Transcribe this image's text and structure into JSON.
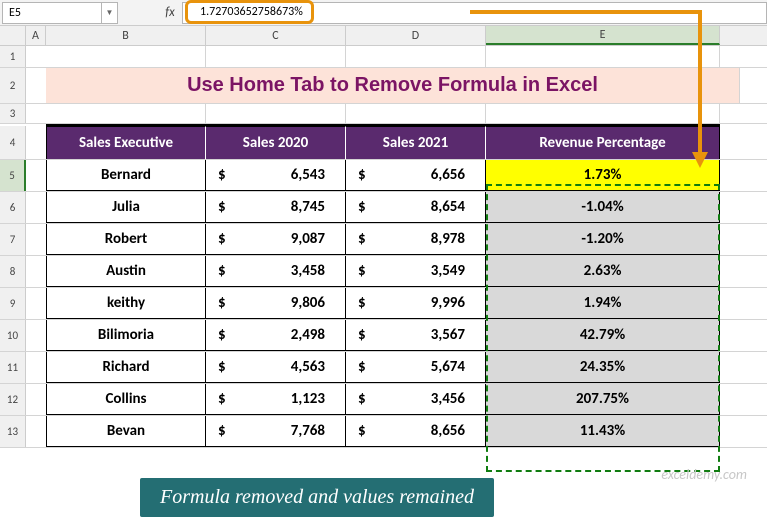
{
  "name_box": "E5",
  "formula_bar": "1.72703652758673%",
  "col_headers": {
    "A": "A",
    "B": "B",
    "C": "C",
    "D": "D",
    "E": "E"
  },
  "row_headers": [
    "1",
    "2",
    "3",
    "4",
    "5",
    "6",
    "7",
    "8",
    "9",
    "10",
    "11",
    "12",
    "13"
  ],
  "title": "Use Home Tab to Remove Formula in Excel",
  "headers": {
    "exec": "Sales Executive",
    "s2020": "Sales 2020",
    "s2021": "Sales 2021",
    "rev": "Revenue Percentage"
  },
  "rows": [
    {
      "exec": "Bernard",
      "s20": "6,543",
      "s21": "6,656",
      "pct": "1.73%"
    },
    {
      "exec": "Julia",
      "s20": "8,745",
      "s21": "8,654",
      "pct": "-1.04%"
    },
    {
      "exec": "Robert",
      "s20": "9,087",
      "s21": "8,978",
      "pct": "-1.20%"
    },
    {
      "exec": "Austin",
      "s20": "3,458",
      "s21": "3,549",
      "pct": "2.63%"
    },
    {
      "exec": "keithy",
      "s20": "9,806",
      "s21": "9,996",
      "pct": "1.94%"
    },
    {
      "exec": "Bilimoria",
      "s20": "2,498",
      "s21": "3,567",
      "pct": "42.79%"
    },
    {
      "exec": "Richard",
      "s20": "4,563",
      "s21": "5,674",
      "pct": "24.35%"
    },
    {
      "exec": "Collins",
      "s20": "1,123",
      "s21": "3,456",
      "pct": "207.75%"
    },
    {
      "exec": "Bevan",
      "s20": "7,768",
      "s21": "8,656",
      "pct": "11.43%"
    }
  ],
  "currency": "$",
  "note": "Formula removed and values remained",
  "watermark": "exceldemy.com",
  "chart_data": {
    "type": "table",
    "title": "Use Home Tab to Remove Formula in Excel",
    "columns": [
      "Sales Executive",
      "Sales 2020",
      "Sales 2021",
      "Revenue Percentage"
    ],
    "series": [
      {
        "name": "Bernard",
        "values": [
          6543,
          6656,
          1.73
        ]
      },
      {
        "name": "Julia",
        "values": [
          8745,
          8654,
          -1.04
        ]
      },
      {
        "name": "Robert",
        "values": [
          9087,
          8978,
          -1.2
        ]
      },
      {
        "name": "Austin",
        "values": [
          3458,
          3549,
          2.63
        ]
      },
      {
        "name": "keithy",
        "values": [
          9806,
          9996,
          1.94
        ]
      },
      {
        "name": "Bilimoria",
        "values": [
          2498,
          3567,
          42.79
        ]
      },
      {
        "name": "Richard",
        "values": [
          4563,
          5674,
          24.35
        ]
      },
      {
        "name": "Collins",
        "values": [
          1123,
          3456,
          207.75
        ]
      },
      {
        "name": "Bevan",
        "values": [
          7768,
          8656,
          11.43
        ]
      }
    ]
  }
}
